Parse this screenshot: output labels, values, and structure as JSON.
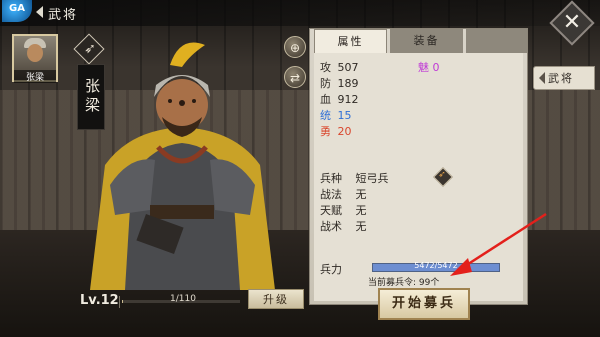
{
  "header": {
    "app_logo_text": "GA",
    "title": "武将"
  },
  "hero": {
    "portrait_name": "张梁",
    "name": "张梁",
    "level": "Lv.12",
    "exp_text": "1/110",
    "exp_fraction": 0.01,
    "upgrade_label": "升级"
  },
  "panel": {
    "tabs": [
      {
        "label": "属性",
        "active": true
      },
      {
        "label": "装备",
        "active": false
      }
    ],
    "stats": {
      "attack": {
        "label": "攻",
        "value": "507"
      },
      "defense": {
        "label": "防",
        "value": "189"
      },
      "hp": {
        "label": "血",
        "value": "912"
      },
      "command": {
        "label": "统",
        "value": "15"
      },
      "bravery": {
        "label": "勇",
        "value": "20"
      },
      "charm": {
        "label": "魅",
        "value": "0"
      }
    },
    "traits": {
      "troop_type": {
        "label": "兵种",
        "value": "短弓兵"
      },
      "tactic": {
        "label": "战法",
        "value": "无"
      },
      "talent": {
        "label": "天赋",
        "value": "无"
      },
      "strategy": {
        "label": "战术",
        "value": "无"
      }
    },
    "strength": {
      "label": "兵力",
      "text": "5472/5472",
      "fraction": 1.0
    },
    "recruit_order_text": "当前募兵令: 99个",
    "recruit_button_label": "开始募兵"
  },
  "side_tab": {
    "label": "武将"
  },
  "colors": {
    "command_blue": "#2f6fd6",
    "bravery_red": "#d9472e",
    "charm_purple": "#c03bd6",
    "annotation_red": "#e3201b"
  },
  "icons": {
    "close": "close-icon",
    "zoom": "zoom-in-icon",
    "swap": "swap-icon",
    "bow": "bow-icon",
    "back": "back-arrow-icon"
  }
}
